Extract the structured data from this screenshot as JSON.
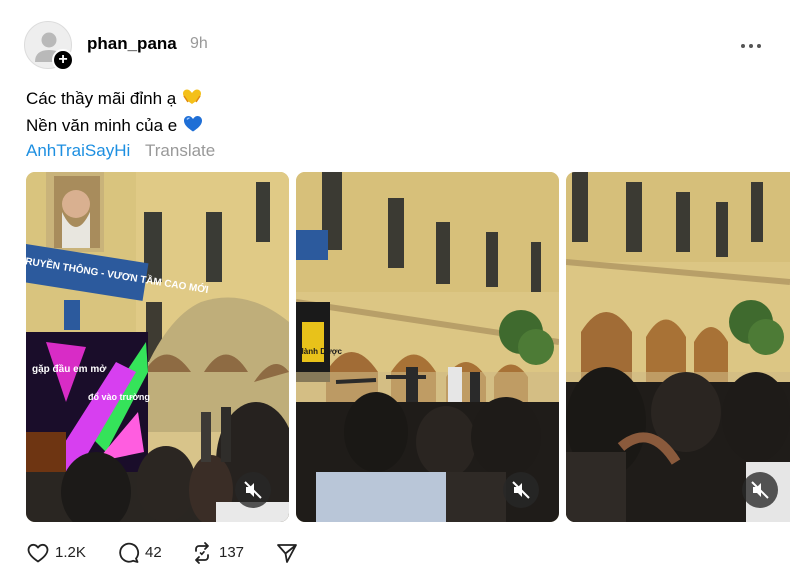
{
  "post": {
    "username": "phan_pana",
    "timestamp": "9h",
    "caption_line1": "Các thầy mãi đỉnh ạ",
    "caption_line2": "Nền văn minh của e",
    "hashtag": "AnhTraiSayHi",
    "translate_label": "Translate"
  },
  "media": [
    {
      "type": "video",
      "muted": true,
      "overlay_top": "RUYỀN THÔNG - VƯƠN TẦM CAO MỚI",
      "overlay_screen1": "gặp đầu em mở",
      "overlay_screen2": "đổ vào trường"
    },
    {
      "type": "video",
      "muted": true,
      "overlay_side": "Hành Dược"
    },
    {
      "type": "video",
      "muted": true
    }
  ],
  "stats": {
    "likes": "1.2K",
    "replies": "42",
    "reposts": "137"
  },
  "icons": {
    "like": "heart-icon",
    "reply": "comment-icon",
    "repost": "repost-icon",
    "share": "send-icon",
    "mute": "speaker-muted-icon",
    "more": "more-icon"
  },
  "colors": {
    "hashtag": "#1d8fe1",
    "muted_text": "#999999"
  }
}
